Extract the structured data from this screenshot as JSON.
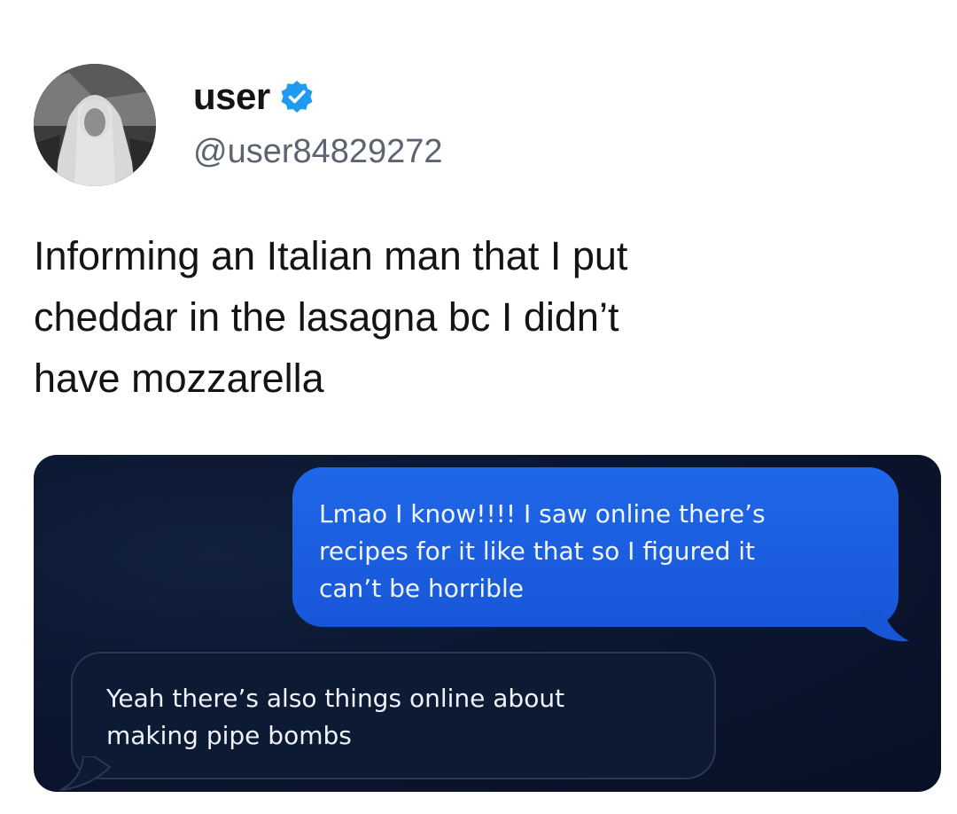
{
  "user": {
    "display_name": "user",
    "handle": "@user84829272",
    "verified": true
  },
  "tweet": {
    "text_lines": [
      "Informing an Italian man that I put",
      "cheddar in the lasagna bc I didn’t",
      "have mozzarella"
    ]
  },
  "messages": {
    "sent": {
      "lines": [
        "Lmao I know!!!! I saw online there’s",
        "recipes for it like that so I figured it",
        "can’t be horrible"
      ]
    },
    "received": {
      "lines": [
        "Yeah there’s also things online about",
        "making pipe bombs"
      ]
    }
  },
  "colors": {
    "verified_badge": "#1d9bf0",
    "sent_bubble": "#1f67e8",
    "panel_background": "#0b1630",
    "received_bubble": "#0d1a33"
  }
}
